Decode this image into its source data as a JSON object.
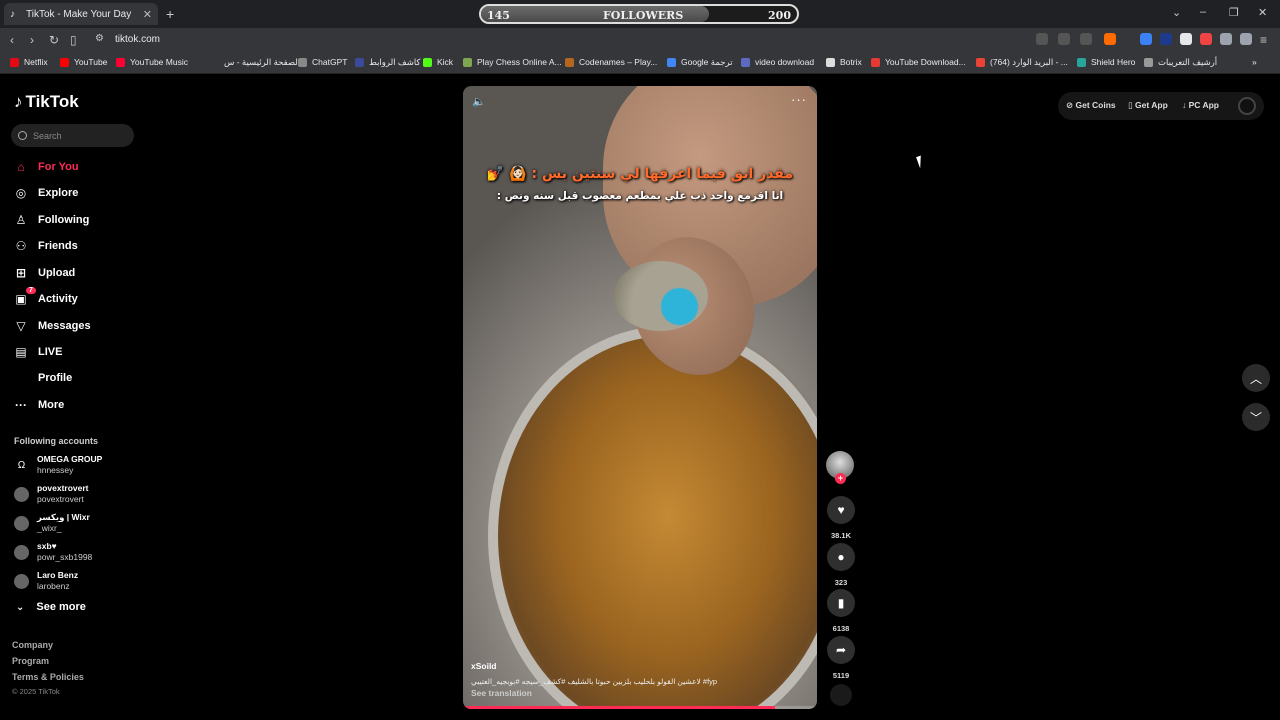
{
  "browser": {
    "tab_title": "TikTok - Make Your Day",
    "new_tab": "+",
    "url": "tiktok.com",
    "followers": {
      "left": "145",
      "label": "FOLLOWERS",
      "right": "200",
      "progress": 0.72
    },
    "window_controls": {
      "chevron": "⌄",
      "minimize": "–",
      "restore": "❐",
      "close": "✕"
    },
    "bookmarks": [
      {
        "label": "Netflix",
        "color": "#e50914"
      },
      {
        "label": "YouTube",
        "color": "#ff0000"
      },
      {
        "label": "YouTube Music",
        "color": "#ff0033"
      },
      {
        "label": "الصفحة الرئيسية - س...",
        "color": "#35363a"
      },
      {
        "label": "ChatGPT",
        "color": "#888888"
      },
      {
        "label": "كاشف الروابط",
        "color": "#3b4a9a"
      },
      {
        "label": "Kick",
        "color": "#53fc18"
      },
      {
        "label": "Play Chess Online A...",
        "color": "#7fa650"
      },
      {
        "label": "Codenames – Play...",
        "color": "#b5651d"
      },
      {
        "label": "Google ترجمة",
        "color": "#4285f4"
      },
      {
        "label": "video download",
        "color": "#5c6bc0"
      },
      {
        "label": "Botrix",
        "color": "#dddddd"
      },
      {
        "label": "YouTube Download...",
        "color": "#e53935"
      },
      {
        "label": "(764) البريد الوارد - ...",
        "color": "#ea4335"
      },
      {
        "label": "Shield Hero",
        "color": "#26a69a"
      },
      {
        "label": "أرشيف التعريبات",
        "color": "#999999"
      }
    ]
  },
  "sidebar": {
    "logo": "TikTok",
    "search_placeholder": "Search",
    "nav": [
      {
        "label": "For You",
        "icon": "home-icon",
        "active": true
      },
      {
        "label": "Explore",
        "icon": "compass-icon"
      },
      {
        "label": "Following",
        "icon": "user-check-icon"
      },
      {
        "label": "Friends",
        "icon": "users-icon"
      },
      {
        "label": "Upload",
        "icon": "plus-square-icon"
      },
      {
        "label": "Activity",
        "icon": "inbox-icon",
        "badge": "7"
      },
      {
        "label": "Messages",
        "icon": "send-icon"
      },
      {
        "label": "LIVE",
        "icon": "live-icon"
      },
      {
        "label": "Profile",
        "icon": ""
      },
      {
        "label": "More",
        "icon": "ellipsis-icon"
      }
    ],
    "following_title": "Following accounts",
    "accounts": [
      {
        "name": "OMEGA GROUP",
        "handle": "hnnessey"
      },
      {
        "name": "povextrovert",
        "handle": "povextrovert"
      },
      {
        "name": "ويكسر | Wixr",
        "handle": "_wixr_"
      },
      {
        "name": "sxb♥",
        "handle": "powr_sxb1998"
      },
      {
        "name": "Laro Benz",
        "handle": "larobenz"
      }
    ],
    "see_more": "See more",
    "footer": [
      "Company",
      "Program",
      "Terms & Policies"
    ],
    "copyright": "© 2025 TikTok"
  },
  "video": {
    "overlay_line1": "مقدر انق فيما اعرفها لي سنتين بس : 🙆🏻 💅",
    "overlay_line2": "انا اقرمع واحد ذب علي بمطعم معصوب قبل سنه ونص :",
    "author": "xSoild",
    "description": "لاعشين القولو بلحليب  بلزبين حبوتا بالشليف  #كشف_سيجه  #بوبجيه_العتيبي  #fyp",
    "see_translation": "See translation",
    "progress": 0.88
  },
  "actions": {
    "likes": "38.1K",
    "comments": "323",
    "saves": "6138",
    "shares": "5119"
  },
  "topright": {
    "get_coins": "Get Coins",
    "get_app": "Get App",
    "pc_app": "PC App"
  }
}
